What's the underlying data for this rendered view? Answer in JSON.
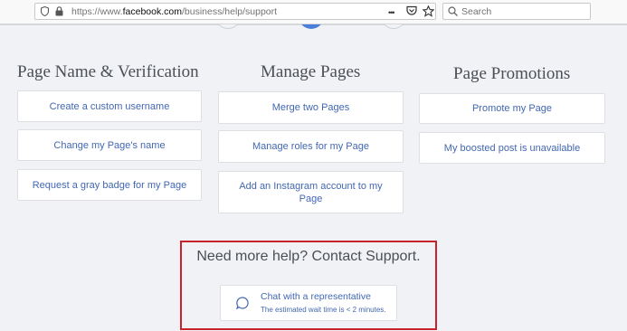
{
  "browser": {
    "url_prefix": "https://www.",
    "url_domain": "facebook.com",
    "url_path": "/business/help/support",
    "search_placeholder": "Search",
    "more_glyph": "•••"
  },
  "colors": {
    "active_step": "#4a7fd8",
    "link": "#4267b2",
    "highlight_border": "#c8232c"
  },
  "columns": [
    {
      "title": "Page Name & Verification",
      "items": [
        "Create a custom username",
        "Change my Page's name",
        "Request a gray badge for my Page"
      ]
    },
    {
      "title": "Manage Pages",
      "items": [
        "Merge two Pages",
        "Manage roles for my Page",
        "Add an Instagram account to my Page"
      ]
    },
    {
      "title": "Page Promotions",
      "items": [
        "Promote my Page",
        "My boosted post is unavailable"
      ]
    }
  ],
  "support": {
    "title": "Need more help? Contact Support.",
    "chat_label": "Chat with a representative",
    "wait_text": "The estimated wait time is < 2 minutes."
  }
}
